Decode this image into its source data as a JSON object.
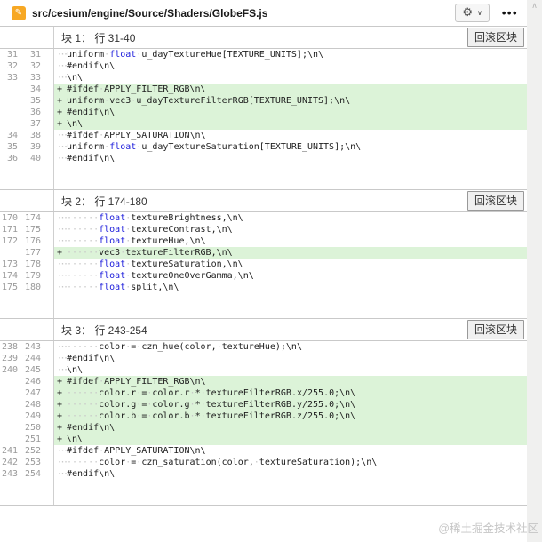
{
  "header": {
    "file_path": "src/cesium/engine/Source/Shaders/GlobeFS.js",
    "file_icon": "edit-pencil-icon",
    "gear_icon": "⚙",
    "chevron": "∨",
    "more_label": "•••"
  },
  "watermark": "@稀土掘金技术社区",
  "scrollbar": {
    "up_arrow": "∧"
  },
  "colors": {
    "added_bg": "#dcf3d8",
    "keyword_blue": "#1c1cdb",
    "file_icon_bg": "#f7a824",
    "line_number_gray": "#9a9a9a",
    "border_gray": "#c9c9c9"
  },
  "blocks": [
    {
      "title": "块 1： 行 31-40",
      "rollback_label": "回滚区块",
      "lines": [
        {
          "old": "31",
          "new": "31",
          "type": "ctx",
          "indent": 0,
          "code": [
            [
              "uniform ",
              "p"
            ],
            [
              "float",
              "k"
            ],
            [
              " u_dayTextureHue[TEXTURE_UNITS];\\n\\",
              "p"
            ]
          ]
        },
        {
          "old": "32",
          "new": "32",
          "type": "ctx",
          "indent": 0,
          "code": [
            [
              "#endif\\n\\",
              "p"
            ]
          ]
        },
        {
          "old": "33",
          "new": "33",
          "type": "ctx",
          "indent": 0,
          "code": [
            [
              "\\n\\",
              "p"
            ]
          ]
        },
        {
          "old": "",
          "new": "34",
          "type": "add",
          "indent": 0,
          "code": [
            [
              "#ifdef APPLY_FILTER_RGB\\n\\",
              "p"
            ]
          ]
        },
        {
          "old": "",
          "new": "35",
          "type": "add",
          "indent": 0,
          "code": [
            [
              "uniform vec3 u_dayTextureFilterRGB[TEXTURE_UNITS];\\n\\",
              "p"
            ]
          ]
        },
        {
          "old": "",
          "new": "36",
          "type": "add",
          "indent": 0,
          "code": [
            [
              "#endif\\n\\",
              "p"
            ]
          ]
        },
        {
          "old": "",
          "new": "37",
          "type": "add",
          "indent": 0,
          "code": [
            [
              "\\n\\",
              "p"
            ]
          ]
        },
        {
          "old": "34",
          "new": "38",
          "type": "ctx",
          "indent": 0,
          "code": [
            [
              "#ifdef APPLY_SATURATION\\n\\",
              "p"
            ]
          ]
        },
        {
          "old": "35",
          "new": "39",
          "type": "ctx",
          "indent": 0,
          "code": [
            [
              "uniform ",
              "p"
            ],
            [
              "float",
              "k"
            ],
            [
              " u_dayTextureSaturation[TEXTURE_UNITS];\\n\\",
              "p"
            ]
          ]
        },
        {
          "old": "36",
          "new": "40",
          "type": "ctx",
          "indent": 0,
          "code": [
            [
              "#endif\\n\\",
              "p"
            ]
          ]
        }
      ]
    },
    {
      "title": "块 2： 行 174-180",
      "rollback_label": "回滚区块",
      "lines": [
        {
          "old": "170",
          "new": "174",
          "type": "ctx",
          "indent": 6,
          "code": [
            [
              "float",
              "k"
            ],
            [
              " textureBrightness,\\n\\",
              "p"
            ]
          ]
        },
        {
          "old": "171",
          "new": "175",
          "type": "ctx",
          "indent": 6,
          "code": [
            [
              "float",
              "k"
            ],
            [
              " textureContrast,\\n\\",
              "p"
            ]
          ]
        },
        {
          "old": "172",
          "new": "176",
          "type": "ctx",
          "indent": 6,
          "code": [
            [
              "float",
              "k"
            ],
            [
              " textureHue,\\n\\",
              "p"
            ]
          ]
        },
        {
          "old": "",
          "new": "177",
          "type": "add",
          "indent": 6,
          "code": [
            [
              "vec3 textureFilterRGB,\\n\\",
              "p"
            ]
          ]
        },
        {
          "old": "173",
          "new": "178",
          "type": "ctx",
          "indent": 6,
          "code": [
            [
              "float",
              "k"
            ],
            [
              " textureSaturation,\\n\\",
              "p"
            ]
          ]
        },
        {
          "old": "174",
          "new": "179",
          "type": "ctx",
          "indent": 6,
          "code": [
            [
              "float",
              "k"
            ],
            [
              " textureOneOverGamma,\\n\\",
              "p"
            ]
          ]
        },
        {
          "old": "175",
          "new": "180",
          "type": "ctx",
          "indent": 6,
          "code": [
            [
              "float",
              "k"
            ],
            [
              " split,\\n\\",
              "p"
            ]
          ]
        }
      ]
    },
    {
      "title": "块 3： 行 243-254",
      "rollback_label": "回滚区块",
      "lines": [
        {
          "old": "238",
          "new": "243",
          "type": "ctx",
          "indent": 6,
          "code": [
            [
              "color = czm_hue(color, textureHue);\\n\\",
              "p"
            ]
          ]
        },
        {
          "old": "239",
          "new": "244",
          "type": "ctx",
          "indent": 0,
          "code": [
            [
              "#endif\\n\\",
              "p"
            ]
          ]
        },
        {
          "old": "240",
          "new": "245",
          "type": "ctx",
          "indent": 0,
          "code": [
            [
              "\\n\\",
              "p"
            ]
          ]
        },
        {
          "old": "",
          "new": "246",
          "type": "add",
          "indent": 0,
          "code": [
            [
              "#ifdef APPLY_FILTER_RGB\\n\\",
              "p"
            ]
          ]
        },
        {
          "old": "",
          "new": "247",
          "type": "add",
          "indent": 6,
          "code": [
            [
              "color.r = color.r * textureFilterRGB.x/255.0;\\n\\",
              "p"
            ]
          ]
        },
        {
          "old": "",
          "new": "248",
          "type": "add",
          "indent": 6,
          "code": [
            [
              "color.g = color.g * textureFilterRGB.y/255.0;\\n\\",
              "p"
            ]
          ]
        },
        {
          "old": "",
          "new": "249",
          "type": "add",
          "indent": 6,
          "code": [
            [
              "color.b = color.b * textureFilterRGB.z/255.0;\\n\\",
              "p"
            ]
          ]
        },
        {
          "old": "",
          "new": "250",
          "type": "add",
          "indent": 0,
          "code": [
            [
              "#endif\\n\\",
              "p"
            ]
          ]
        },
        {
          "old": "",
          "new": "251",
          "type": "add",
          "indent": 0,
          "code": [
            [
              "\\n\\",
              "p"
            ]
          ]
        },
        {
          "old": "241",
          "new": "252",
          "type": "ctx",
          "indent": 0,
          "code": [
            [
              "#ifdef APPLY_SATURATION\\n\\",
              "p"
            ]
          ]
        },
        {
          "old": "242",
          "new": "253",
          "type": "ctx",
          "indent": 6,
          "code": [
            [
              "color = czm_saturation(color, textureSaturation);\\n\\",
              "p"
            ]
          ]
        },
        {
          "old": "243",
          "new": "254",
          "type": "ctx",
          "indent": 0,
          "code": [
            [
              "#endif\\n\\",
              "p"
            ]
          ]
        }
      ]
    }
  ]
}
